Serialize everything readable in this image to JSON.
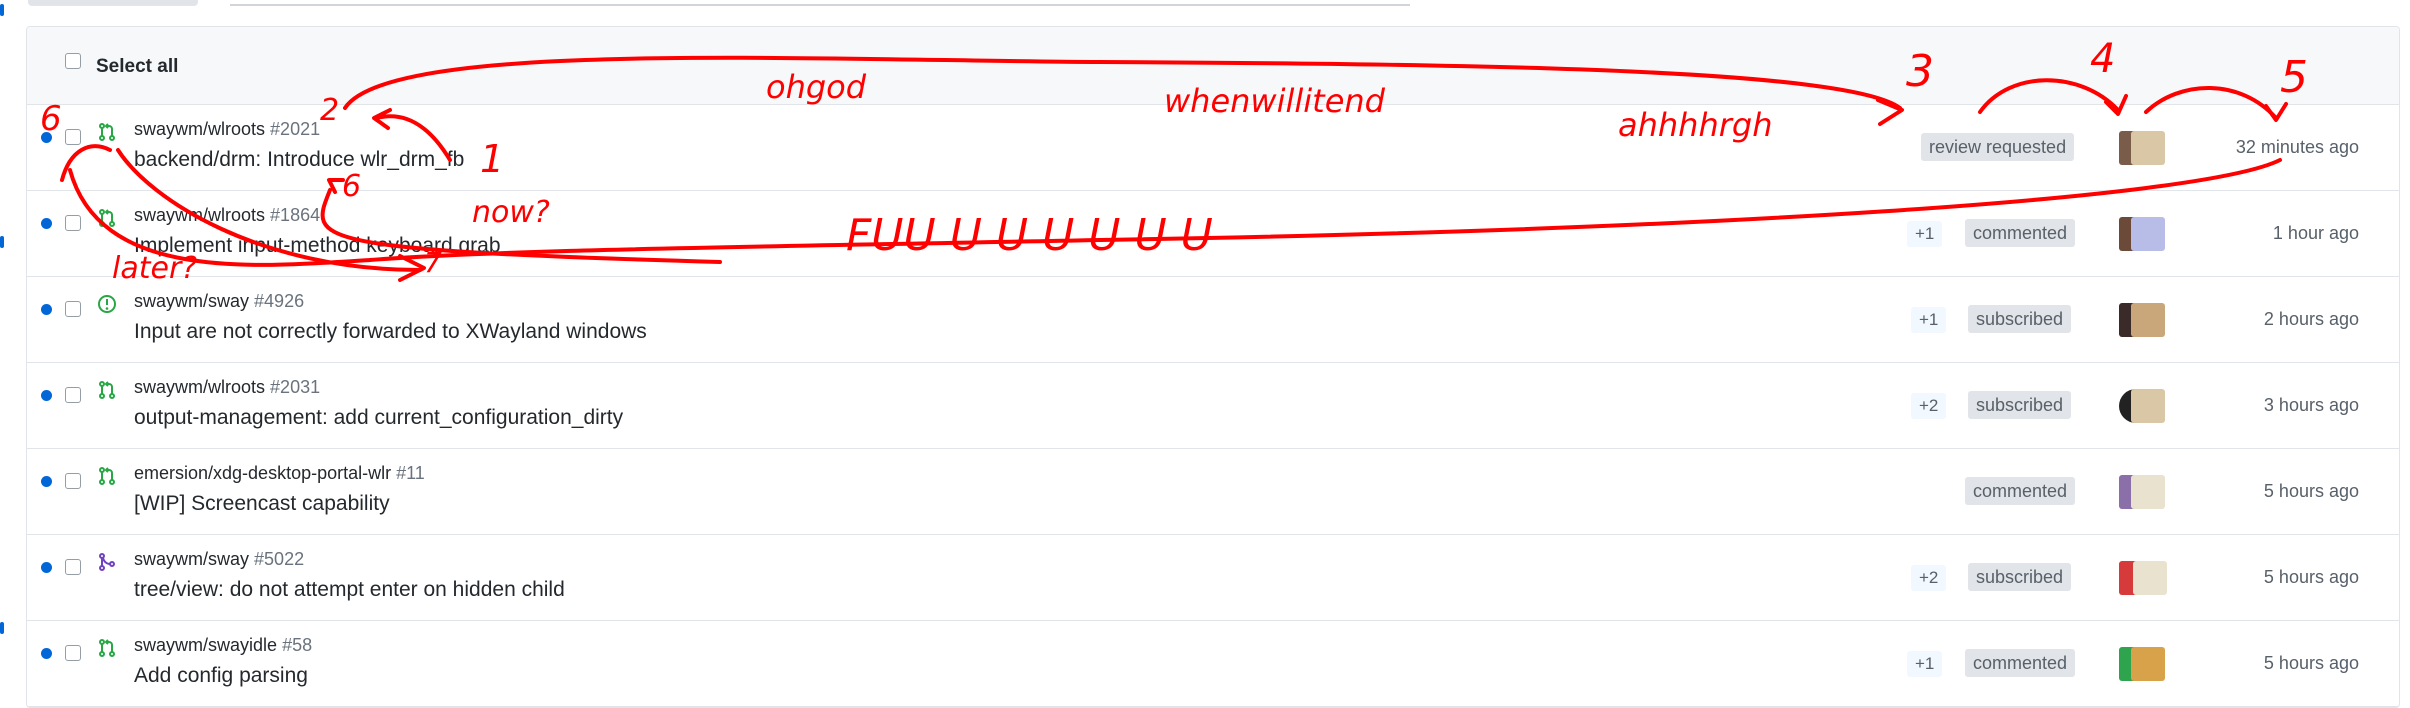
{
  "header": {
    "select_all_label": "Select all"
  },
  "notifications": [
    {
      "repo": "swaywm/wlroots",
      "number": "#2021",
      "title": "backend/drm: Introduce wlr_drm_fb",
      "type": "pull-request",
      "plus": "",
      "reason": "review requested",
      "time": "32 minutes ago"
    },
    {
      "repo": "swaywm/wlroots",
      "number": "#1864",
      "title": "Implement input-method keyboard grab",
      "type": "pull-request",
      "plus": "+1",
      "reason": "commented",
      "time": "1 hour ago"
    },
    {
      "repo": "swaywm/sway",
      "number": "#4926",
      "title": "Input are not correctly forwarded to XWayland windows",
      "type": "issue",
      "plus": "+1",
      "reason": "subscribed",
      "time": "2 hours ago"
    },
    {
      "repo": "swaywm/wlroots",
      "number": "#2031",
      "title": "output-management: add current_configuration_dirty",
      "type": "pull-request",
      "plus": "+2",
      "reason": "subscribed",
      "time": "3 hours ago"
    },
    {
      "repo": "emersion/xdg-desktop-portal-wlr",
      "number": "#11",
      "title": "[WIP] Screencast capability",
      "type": "pull-request",
      "plus": "",
      "reason": "commented",
      "time": "5 hours ago"
    },
    {
      "repo": "swaywm/sway",
      "number": "#5022",
      "title": "tree/view: do not attempt enter on hidden child",
      "type": "merged-pull-request",
      "plus": "+2",
      "reason": "subscribed",
      "time": "5 hours ago"
    },
    {
      "repo": "swaywm/swayidle",
      "number": "#58",
      "title": "Add config parsing",
      "type": "pull-request",
      "plus": "+1",
      "reason": "commented",
      "time": "5 hours ago"
    }
  ],
  "annotations": {
    "numbers": [
      "1",
      "2",
      "3",
      "4",
      "5",
      "6",
      "6",
      "7"
    ],
    "words": [
      "ohgod",
      "whenwillitend",
      "ahhhhrgh",
      "now?",
      "later?",
      "FUU U U U U U U"
    ]
  },
  "colors": {
    "unread_dot": "#0366d6",
    "pr_icon": "#28a745",
    "issue_icon": "#28a745",
    "merged_icon": "#6f42c1",
    "annotation": "#ff0000"
  }
}
